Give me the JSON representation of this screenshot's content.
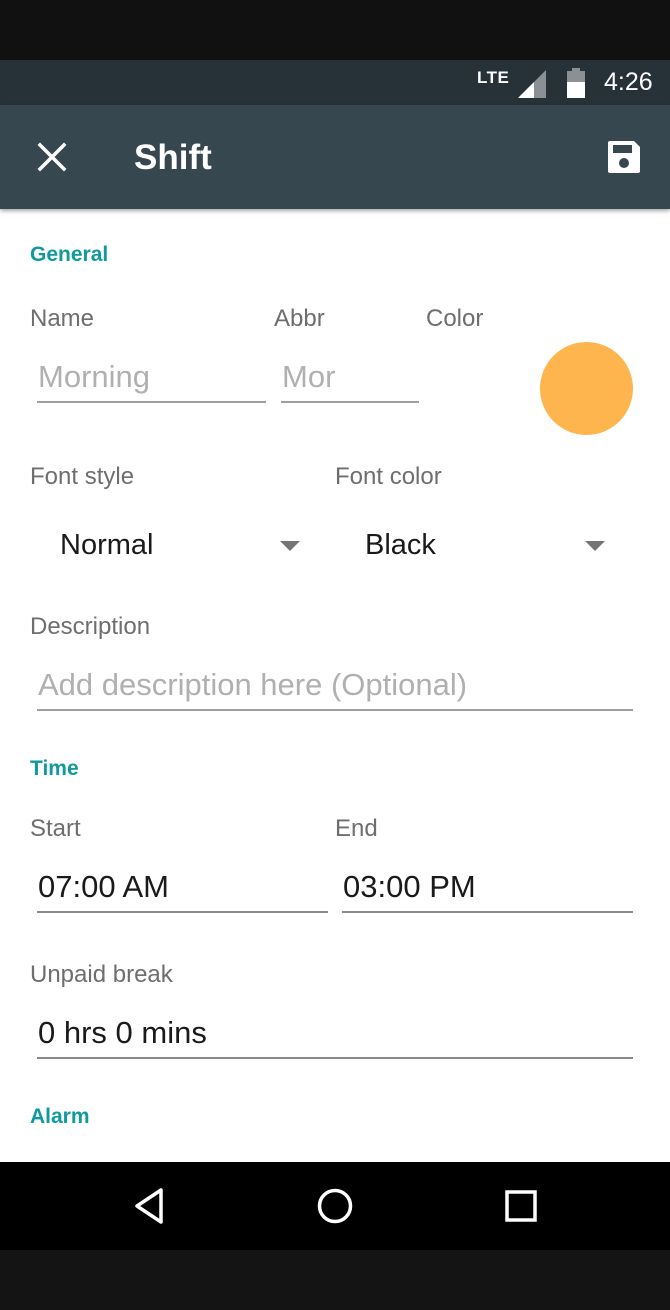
{
  "status_bar": {
    "network": "LTE",
    "time": "4:26",
    "icons": [
      "signal-icon",
      "battery-icon"
    ]
  },
  "app_bar": {
    "title": "Shift",
    "close_icon": "close-icon",
    "save_icon": "save-icon"
  },
  "general": {
    "header": "General",
    "name_label": "Name",
    "name_placeholder": "Morning",
    "abbr_label": "Abbr",
    "abbr_placeholder": "Mor",
    "color_label": "Color",
    "color_value": "#ffb54d",
    "font_style_label": "Font style",
    "font_style_value": "Normal",
    "font_color_label": "Font color",
    "font_color_value": "Black",
    "description_label": "Description",
    "description_placeholder": "Add description here (Optional)"
  },
  "time": {
    "header": "Time",
    "start_label": "Start",
    "start_value": "07:00 AM",
    "end_label": "End",
    "end_value": "03:00 PM",
    "break_label": "Unpaid break",
    "break_value": "0 hrs 0 mins"
  },
  "alarm": {
    "header": "Alarm"
  },
  "nav_bar": {
    "icons": [
      "back-icon",
      "home-icon",
      "recents-icon"
    ]
  },
  "colors": {
    "app_bar": "#37474f",
    "status_bar": "#263238",
    "accent": "#0f9aa0",
    "shift_color": "#ffb54d"
  }
}
